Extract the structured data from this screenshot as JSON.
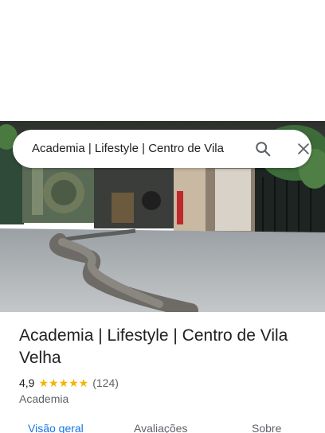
{
  "search": {
    "query": "Academia | Lifestyle | Centro de Vila"
  },
  "icons": {
    "search": "search-icon",
    "close": "close-icon"
  },
  "place": {
    "title": "Academia | Lifestyle | Centro de Vila Velha",
    "rating": "4,9",
    "stars": "★★★★★",
    "review_count": "(124)",
    "category": "Academia"
  },
  "tabs": [
    {
      "label": "Visão geral"
    },
    {
      "label": "Avaliações"
    },
    {
      "label": "Sobre"
    }
  ],
  "colors": {
    "accent": "#1a73e8",
    "star": "#f4b400",
    "text_secondary": "#5f6368"
  }
}
